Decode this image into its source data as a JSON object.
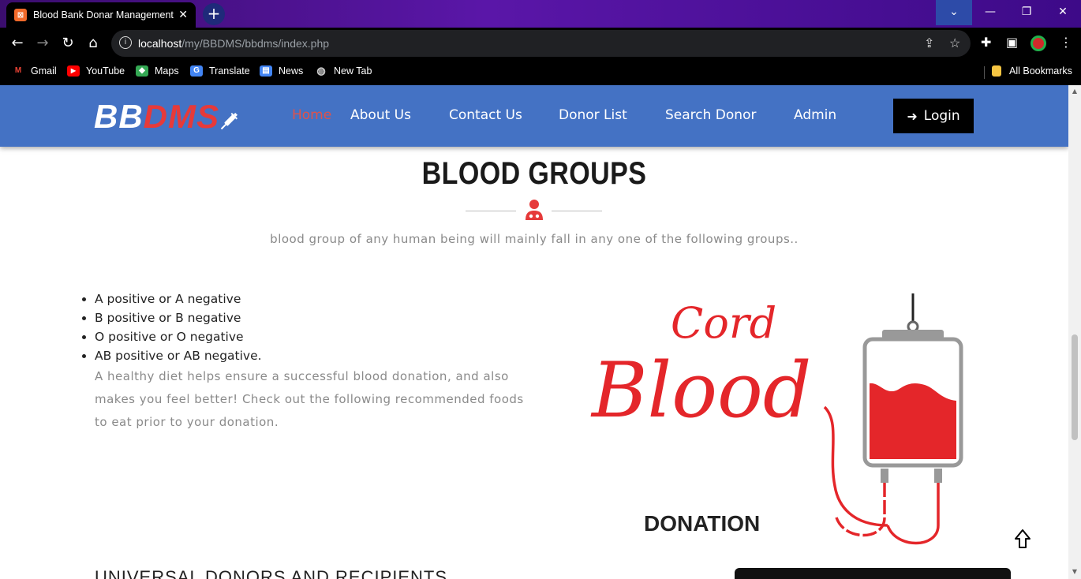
{
  "browser": {
    "tab_title": "Blood Bank Donar Management",
    "tab_close": "✕",
    "new_tab": "+",
    "url_host": "localhost",
    "url_path": "/my/BBDMS/bbdms/index.php",
    "bookmarks": [
      {
        "label": "Gmail",
        "icon": "gmail-icon",
        "color": "#ea4335"
      },
      {
        "label": "YouTube",
        "icon": "youtube-icon",
        "color": "#ff0000"
      },
      {
        "label": "Maps",
        "icon": "maps-icon",
        "color": "#34a853"
      },
      {
        "label": "Translate",
        "icon": "translate-icon",
        "color": "#4285f4"
      },
      {
        "label": "News",
        "icon": "news-icon",
        "color": "#4285f4"
      },
      {
        "label": "New Tab",
        "icon": "globe-icon",
        "color": "#cccccc"
      }
    ],
    "all_bookmarks": "All Bookmarks"
  },
  "site": {
    "logo_white": "BB",
    "logo_red": "DMS",
    "nav": [
      {
        "label": "Home",
        "active": true
      },
      {
        "label": "About Us",
        "active": false
      },
      {
        "label": "Contact Us",
        "active": false
      },
      {
        "label": "Donor List",
        "active": false
      },
      {
        "label": "Search Donor",
        "active": false
      },
      {
        "label": "Admin",
        "active": false
      }
    ],
    "login_label": "Login",
    "colors": {
      "navbar": "#4472c4",
      "accent": "#e63a3a",
      "login_bg": "#000000"
    }
  },
  "section": {
    "title": "BLOOD GROUPS",
    "subtitle": "blood group of any human being will mainly fall in any one of the following groups..",
    "groups": [
      "A positive or A negative",
      "B positive or B negative",
      "O positive or O negative",
      "AB positive or AB negative."
    ],
    "diet_text": "A healthy diet helps ensure a successful blood donation, and also makes you feel better! Check out the following recommended foods to eat prior to your donation.",
    "artwork": {
      "script_top": "Cord",
      "script_main": "Blood",
      "caption": "DONATION"
    },
    "next_heading": "UNIVERSAL DONORS AND RECIPIENTS"
  }
}
